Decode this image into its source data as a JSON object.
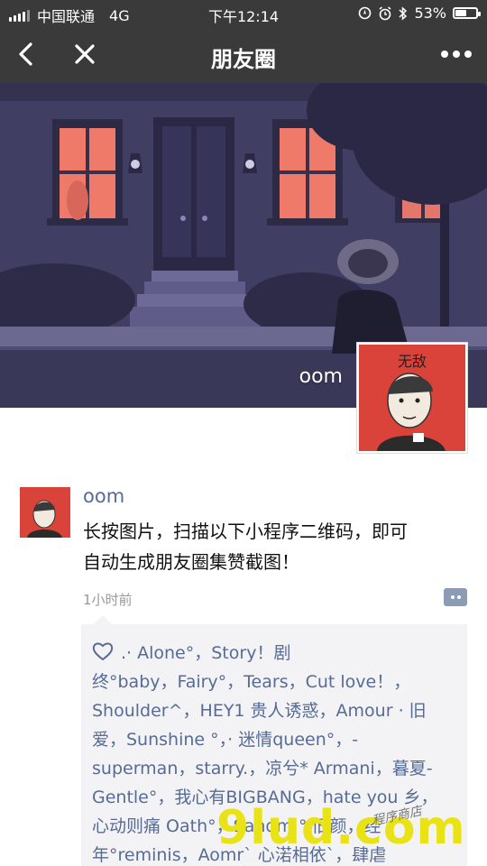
{
  "status_bar": {
    "carrier": "中国联通",
    "network": "4G",
    "time": "下午12:14",
    "battery": "53%",
    "battery_level": 0.53
  },
  "nav": {
    "title": "朋友圈"
  },
  "cover": {
    "name": "oom"
  },
  "post": {
    "author": "oom",
    "text_line1": "长按图片，扫描以下小程序二维码，即可",
    "text_line2": "自动生成朋友圈集赞截图！",
    "time": "1小时前",
    "likes": [
      ".·  Alone°，Story！剧",
      "终°baby，Fairy°，Tears，Cut love！，",
      "Shoulder^，HEY1 贵人诱惑，Amour · 旧",
      "爱，Sunshine °，· 迷情queen°，-",
      "superman，starry.，凉兮* Armani，暮夏-",
      "Gentle°，我心有BIGBANG，hate you 乡，",
      "心动则痛 Oath°，Sandm ° 旧颜，经",
      "年°reminis，Aomr` 心渃相依`，肆虐"
    ]
  },
  "watermark": {
    "big": "9lud.com",
    "small": "程序商店"
  },
  "avatar_caption": "无敌"
}
